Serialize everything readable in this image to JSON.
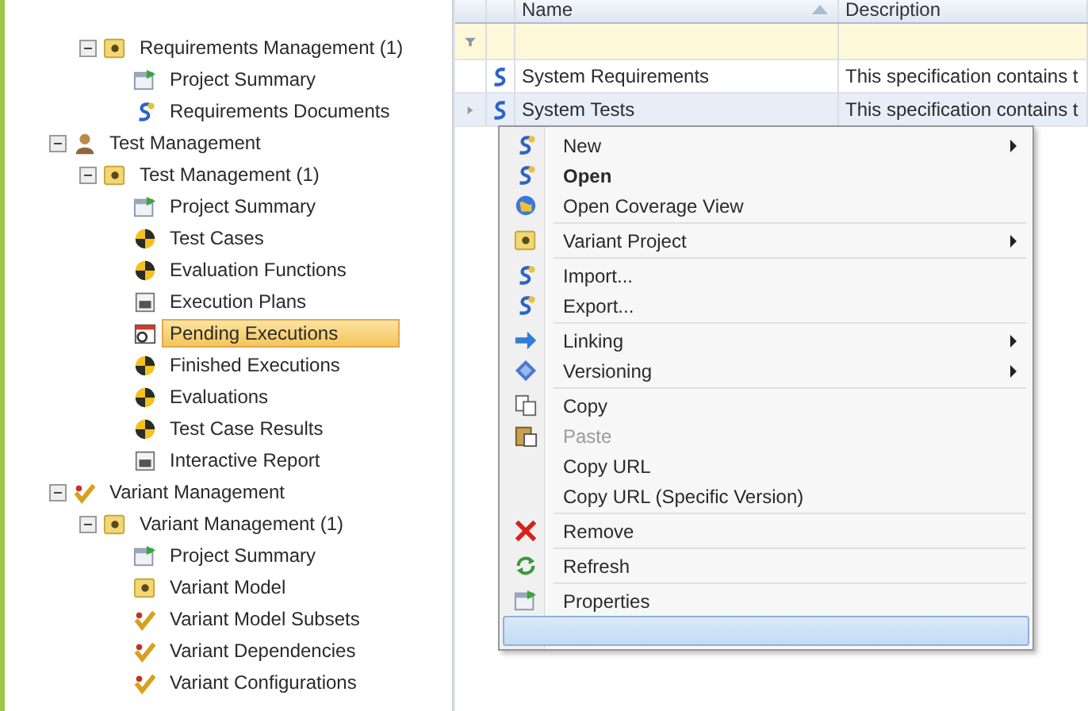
{
  "tree": [
    {
      "children": [
        {
          "label": "Requirements Management (1)",
          "kind": "module",
          "expanded": true,
          "selected": false,
          "children": [
            {
              "label": "Project Summary",
              "kind": "summary",
              "selected": false
            },
            {
              "label": "Requirements Documents",
              "kind": "spec",
              "selected": false
            }
          ]
        }
      ]
    },
    {
      "label": "Test Management",
      "kind": "figure",
      "expanded": true,
      "selected": false,
      "children": [
        {
          "label": "Test Management  (1)",
          "kind": "module",
          "expanded": true,
          "selected": false,
          "children": [
            {
              "label": "Project Summary",
              "kind": "summary",
              "selected": false
            },
            {
              "label": "Test Cases",
              "kind": "disc",
              "selected": false
            },
            {
              "label": "Evaluation Functions",
              "kind": "disc",
              "selected": false
            },
            {
              "label": "Execution Plans",
              "kind": "report",
              "selected": false
            },
            {
              "label": "Pending Executions",
              "kind": "calendar",
              "selected": true
            },
            {
              "label": "Finished Executions",
              "kind": "disc",
              "selected": false
            },
            {
              "label": "Evaluations",
              "kind": "disc",
              "selected": false
            },
            {
              "label": "Test Case Results",
              "kind": "disc",
              "selected": false
            },
            {
              "label": "Interactive Report",
              "kind": "report",
              "selected": false
            }
          ]
        }
      ]
    },
    {
      "label": "Variant Management",
      "kind": "check",
      "expanded": true,
      "selected": false,
      "children": [
        {
          "label": "Variant Management (1)",
          "kind": "module",
          "expanded": true,
          "selected": false,
          "children": [
            {
              "label": "Project Summary",
              "kind": "summary",
              "selected": false
            },
            {
              "label": "Variant Model",
              "kind": "module",
              "selected": false
            },
            {
              "label": "Variant Model Subsets",
              "kind": "check",
              "selected": false
            },
            {
              "label": "Variant Dependencies",
              "kind": "check",
              "selected": false
            },
            {
              "label": "Variant Configurations",
              "kind": "check",
              "selected": false
            }
          ]
        }
      ]
    }
  ],
  "table": {
    "columns": [
      "Name",
      "Description"
    ],
    "rows": [
      {
        "name": "System Requirements",
        "description": "This specification contains t",
        "selected": false
      },
      {
        "name": "System Tests",
        "description": "This specification contains t",
        "selected": true
      }
    ]
  },
  "menu": [
    [
      {
        "kind": "spec",
        "label": "New",
        "submenu": true,
        "bold": false,
        "disabled": false
      },
      {
        "kind": "spec",
        "label": "Open",
        "submenu": false,
        "bold": true,
        "disabled": false
      },
      {
        "kind": "coverage",
        "label": "Open Coverage View",
        "submenu": false,
        "bold": false,
        "disabled": false
      }
    ],
    [
      {
        "kind": "module",
        "label": "Variant Project",
        "submenu": true,
        "bold": false,
        "disabled": false
      }
    ],
    [
      {
        "kind": "spec",
        "label": "Import...",
        "submenu": false,
        "bold": false,
        "disabled": false
      },
      {
        "kind": "spec",
        "label": "Export...",
        "submenu": false,
        "bold": false,
        "disabled": false
      }
    ],
    [
      {
        "kind": "arrow",
        "label": "Linking",
        "submenu": true,
        "bold": false,
        "disabled": false
      },
      {
        "kind": "versions",
        "label": "Versioning",
        "submenu": true,
        "bold": false,
        "disabled": false
      }
    ],
    [
      {
        "kind": "copy",
        "label": "Copy",
        "submenu": false,
        "bold": false,
        "disabled": false
      },
      {
        "kind": "paste",
        "label": "Paste",
        "submenu": false,
        "bold": false,
        "disabled": true
      },
      {
        "kind": "plain",
        "label": "Copy URL",
        "submenu": false,
        "bold": false,
        "disabled": false
      },
      {
        "kind": "plain",
        "label": "Copy URL (Specific Version)",
        "submenu": false,
        "bold": false,
        "disabled": false
      }
    ],
    [
      {
        "kind": "remove",
        "label": "Remove",
        "submenu": false,
        "bold": false,
        "disabled": false
      }
    ],
    [
      {
        "kind": "refresh",
        "label": "Refresh",
        "submenu": false,
        "bold": false,
        "disabled": false
      }
    ],
    [
      {
        "kind": "summary",
        "label": "Properties",
        "submenu": false,
        "bold": false,
        "disabled": false
      },
      {
        "kind": "highlight"
      }
    ]
  ]
}
